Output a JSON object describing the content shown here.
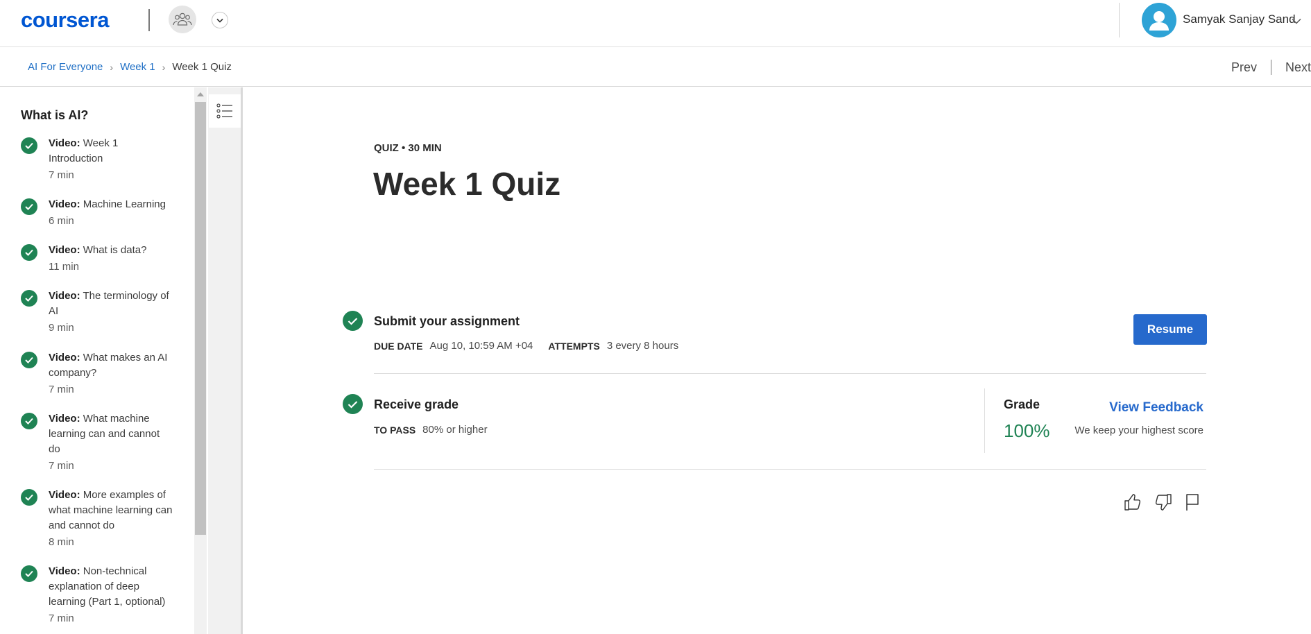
{
  "header": {
    "logo": "coursera",
    "user_name": "Samyak Sanjay Sand"
  },
  "breadcrumb": {
    "items": [
      "AI For Everyone",
      "Week 1"
    ],
    "current": "Week 1 Quiz"
  },
  "nav": {
    "prev": "Prev",
    "next": "Next"
  },
  "sidebar": {
    "module_title": "What is AI?",
    "items": [
      {
        "kind": "Video:",
        "title": "Week 1 Introduction",
        "duration": "7 min"
      },
      {
        "kind": "Video:",
        "title": "Machine Learning",
        "duration": "6 min"
      },
      {
        "kind": "Video:",
        "title": "What is data?",
        "duration": "11 min"
      },
      {
        "kind": "Video:",
        "title": "The terminology of AI",
        "duration": "9 min"
      },
      {
        "kind": "Video:",
        "title": "What makes an AI company?",
        "duration": "7 min"
      },
      {
        "kind": "Video:",
        "title": "What machine learning can and cannot do",
        "duration": "7 min"
      },
      {
        "kind": "Video:",
        "title": "More examples of what machine learning can and cannot do",
        "duration": "8 min"
      },
      {
        "kind": "Video:",
        "title": "Non-technical explanation of deep learning (Part 1, optional)",
        "duration": "7 min"
      }
    ]
  },
  "main": {
    "eyebrow": "QUIZ • 30 MIN",
    "title": "Week 1 Quiz",
    "submit": {
      "heading": "Submit your assignment",
      "due_label": "DUE DATE",
      "due_value": "Aug 10, 10:59 AM +04",
      "attempts_label": "ATTEMPTS",
      "attempts_value": "3 every 8 hours",
      "button": "Resume"
    },
    "receive": {
      "heading": "Receive grade",
      "pass_label": "TO PASS",
      "pass_value": "80% or higher",
      "grade_label": "Grade",
      "grade_value": "100%",
      "view_feedback": "View Feedback",
      "note": "We keep your highest score"
    }
  },
  "colors": {
    "brand": "#0056d2",
    "link": "#1f6fc5",
    "button": "#2669cc",
    "success": "#1f8354",
    "avatar": "#2ea3d6"
  }
}
